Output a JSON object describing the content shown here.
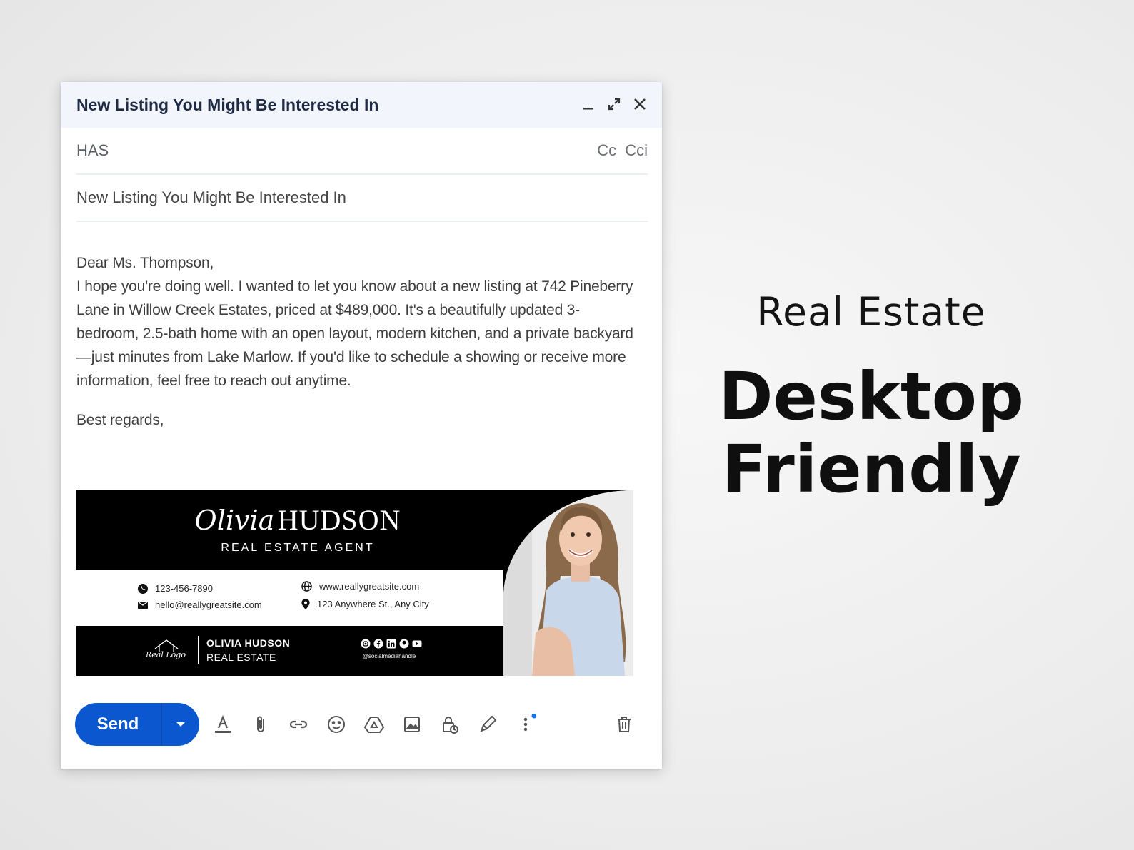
{
  "compose": {
    "window_title": "New Listing You Might Be Interested In",
    "to_value": "HAS",
    "cc_label": "Cc",
    "bcc_label": "Cci",
    "subject": "New Listing You Might Be Interested In",
    "body": {
      "greeting": "Dear Ms. Thompson,",
      "paragraph": "I hope you're doing well. I wanted to let you know about a new listing at 742 Pineberry Lane in Willow Creek Estates, priced at $489,000. It's a beautifully updated 3-bedroom, 2.5-bath home with an open layout, modern kitchen, and a private backyard—just minutes from Lake Marlow. If you'd like to schedule a showing or receive more information, feel free to reach out anytime.",
      "closing": "Best regards,"
    },
    "send_label": "Send"
  },
  "signature": {
    "first_name": "Olivia",
    "last_name": "HUDSON",
    "role": "REAL ESTATE AGENT",
    "phone": "123-456-7890",
    "email": "hello@reallygreatsite.com",
    "website": "www.reallygreatsite.com",
    "address": "123 Anywhere St., Any City",
    "logo_text": "Real Logo",
    "company_name": "OLIVIA HUDSON",
    "company_line": "REAL ESTATE",
    "social_handle": "@socialmediahandle"
  },
  "hero": {
    "subtitle": "Real Estate",
    "title_line1": "Desktop",
    "title_line2": "Friendly"
  },
  "colors": {
    "send_button": "#0b57d0",
    "titlebar_bg": "#f2f6fc",
    "notification_dot": "#1a73e8"
  }
}
